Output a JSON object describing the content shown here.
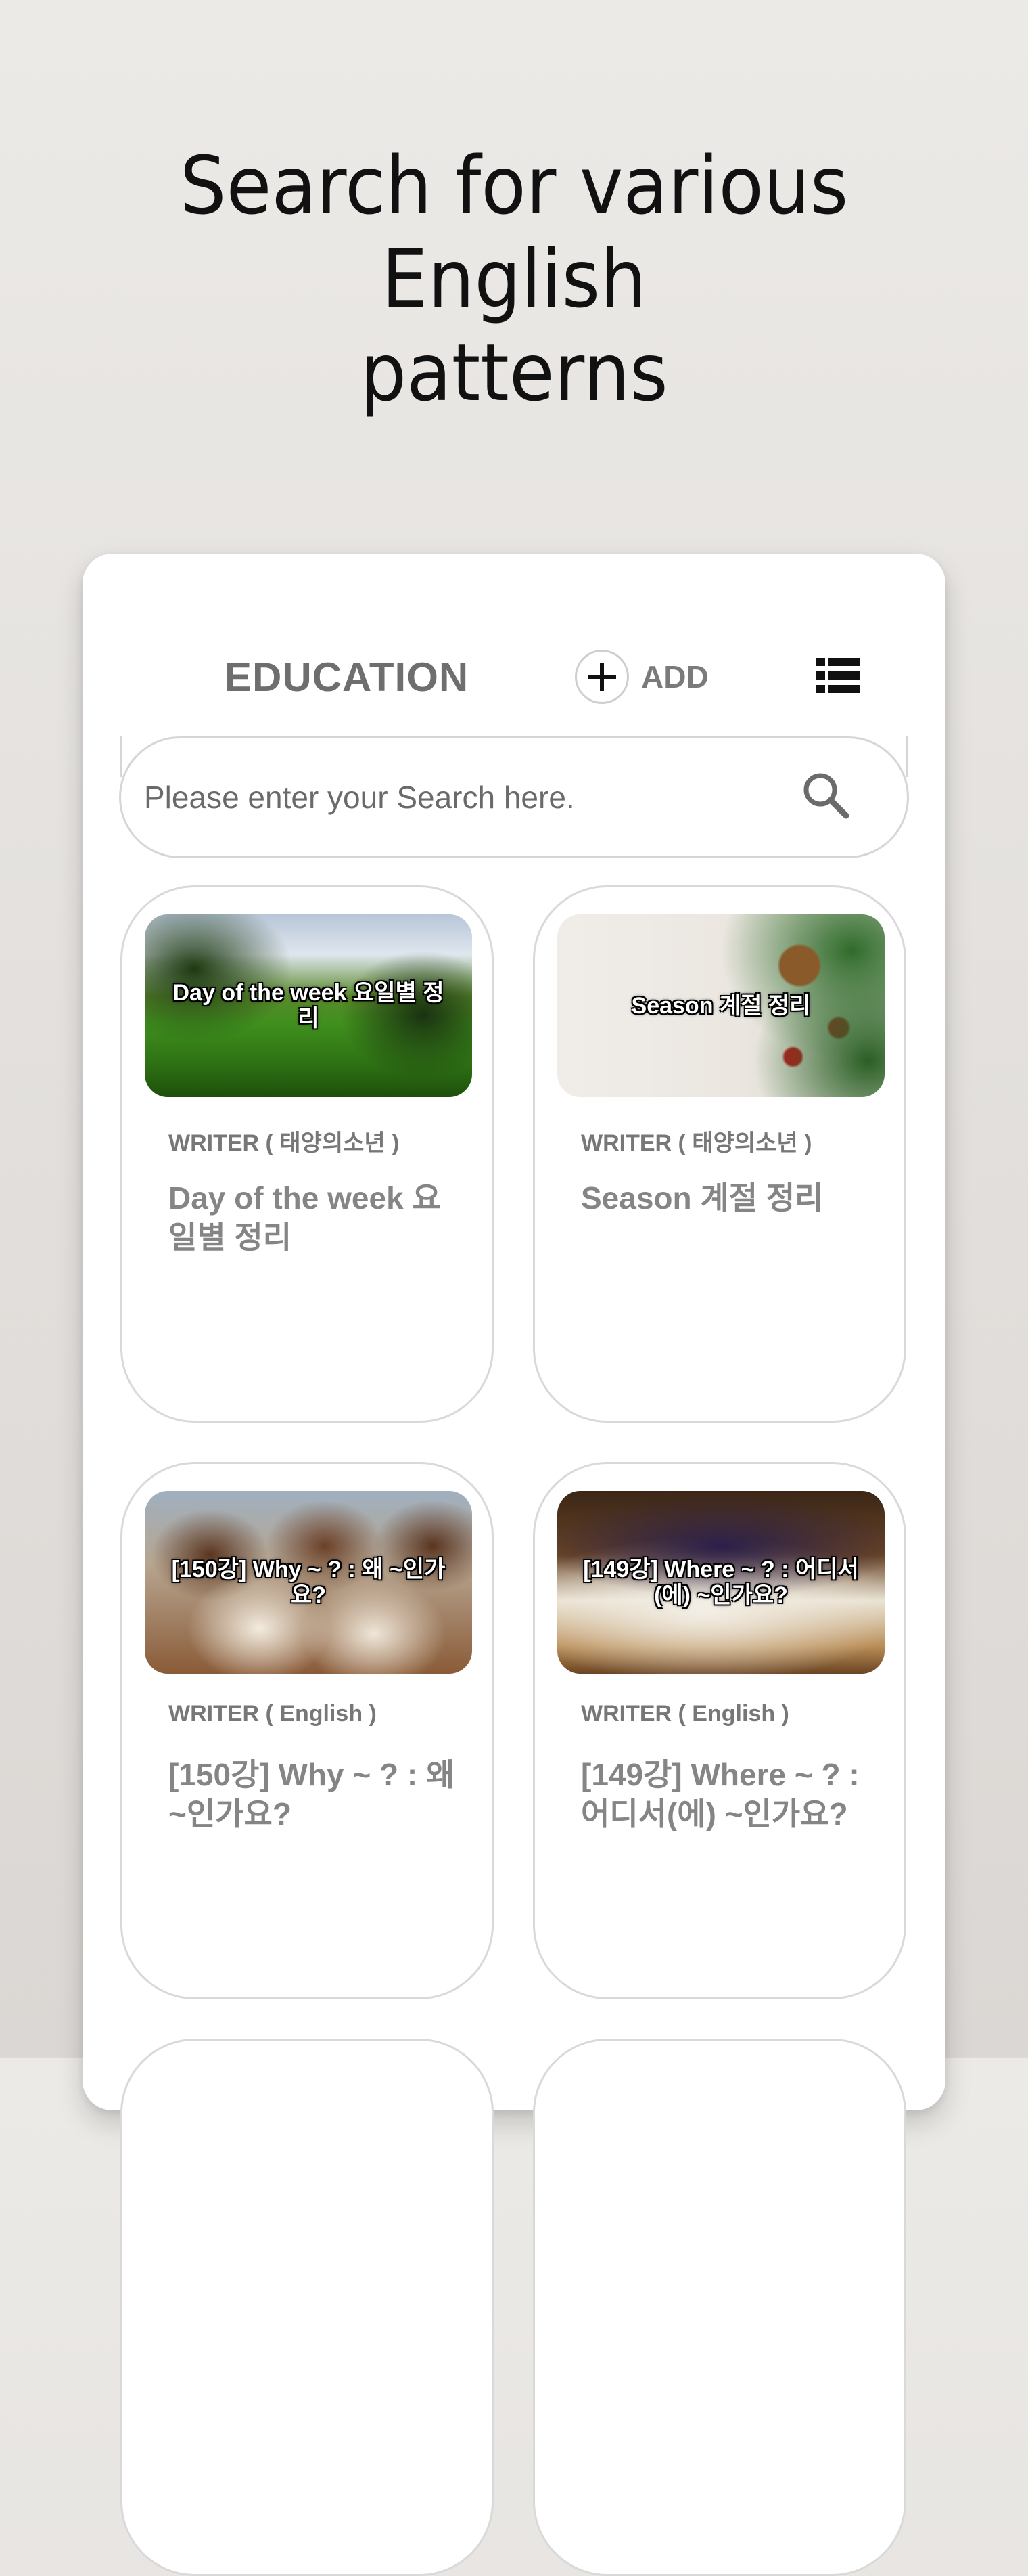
{
  "headline": {
    "line1": "Search for various English",
    "line2": "patterns"
  },
  "header": {
    "title": "EDUCATION",
    "add_label": "ADD"
  },
  "search": {
    "placeholder": "Please enter your Search here.",
    "value": ""
  },
  "cards": [
    {
      "thumbnail_text": "Day of the week 요일별 정리",
      "writer": "WRITER ( 태양의소년 )",
      "title": "Day of the week 요일별 정리"
    },
    {
      "thumbnail_text": "Season 계절 정리",
      "writer": "WRITER ( 태양의소년 )",
      "title": "Season 계절 정리"
    },
    {
      "thumbnail_text": "[150강] Why ~ ? : 왜 ~인가요?",
      "writer": "WRITER ( English )",
      "title": "[150강] Why ~ ? : 왜 ~인가요?"
    },
    {
      "thumbnail_text": "[149강] Where ~ ? : 어디서(에) ~인가요?",
      "writer": "WRITER ( English )",
      "title": "[149강] Where ~ ? : 어디서(에) ~인가요?"
    }
  ],
  "colors": {
    "accent_text": "#6e6e6e",
    "card_border": "#d9d9d9",
    "background": "#e6e3e0"
  },
  "icons": {
    "add": "plus-circle-icon",
    "view": "list-view-icon",
    "search": "search-icon"
  }
}
